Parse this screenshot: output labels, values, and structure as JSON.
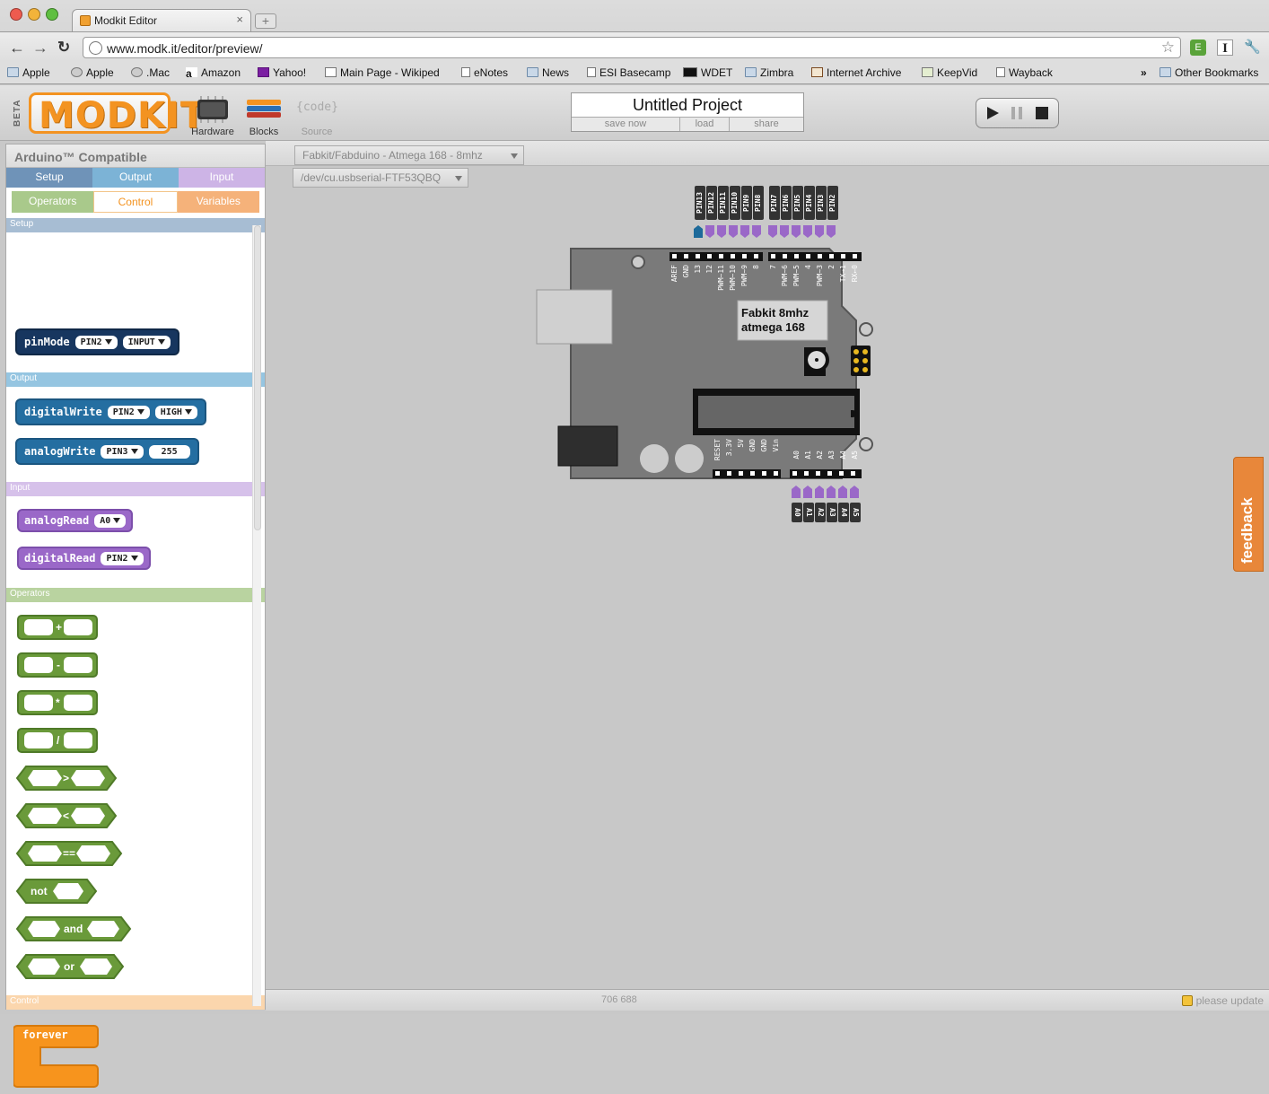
{
  "browser": {
    "tab_title": "Modkit Editor",
    "tab_close": "×",
    "new_tab": "+",
    "url": "www.modk.it/editor/preview/",
    "back": "←",
    "forward": "→",
    "reload": "C",
    "star": "☆",
    "bookmarks": [
      {
        "label": "Apple",
        "icon": "folder-icon"
      },
      {
        "label": "Apple",
        "icon": "apple-icon"
      },
      {
        "label": ".Mac",
        "icon": "apple-icon"
      },
      {
        "label": "Amazon",
        "icon": "amazon-icon"
      },
      {
        "label": "Yahoo!",
        "icon": "yahoo-icon"
      },
      {
        "label": "Main Page - Wikiped",
        "icon": "wikipedia-icon"
      },
      {
        "label": "eNotes",
        "icon": "page-icon"
      },
      {
        "label": "News",
        "icon": "folder-icon"
      },
      {
        "label": "ESI Basecamp",
        "icon": "page-icon"
      },
      {
        "label": "WDET",
        "icon": "wdet-icon"
      },
      {
        "label": "Zimbra",
        "icon": "folder-icon"
      },
      {
        "label": "Internet Archive",
        "icon": "archive-icon"
      },
      {
        "label": "KeepVid",
        "icon": "keepvid-icon"
      },
      {
        "label": "Wayback",
        "icon": "page-icon"
      }
    ],
    "more": "»",
    "other_bookmarks": "Other Bookmarks"
  },
  "app": {
    "logo": "MODKIT",
    "beta": "BETA",
    "modes": [
      {
        "label": "Hardware",
        "icon": "chip-icon"
      },
      {
        "label": "Blocks",
        "icon": "blocks-icon"
      },
      {
        "label": "Source",
        "icon_text": "{code}"
      }
    ],
    "project": {
      "name": "Untitled Project",
      "actions": [
        "save now",
        "load",
        "share"
      ]
    },
    "run_controls": [
      "play",
      "pause",
      "stop"
    ]
  },
  "sidebar": {
    "title": "Arduino™ Compatible",
    "tabs_row1": [
      "Setup",
      "Output",
      "Input"
    ],
    "tabs_row2": [
      "Operators",
      "Control",
      "Variables"
    ],
    "categories": {
      "setup": "Setup",
      "output": "Output",
      "input": "Input",
      "operators": "Operators",
      "control": "Control"
    },
    "blocks": {
      "pinMode": {
        "name": "pinMode",
        "pin": "PIN2",
        "mode": "INPUT"
      },
      "digitalWrite": {
        "name": "digitalWrite",
        "pin": "PIN2",
        "value": "HIGH"
      },
      "analogWrite": {
        "name": "analogWrite",
        "pin": "PIN3",
        "value": "255"
      },
      "analogRead": {
        "name": "analogRead",
        "pin": "A0"
      },
      "digitalRead": {
        "name": "digitalRead",
        "pin": "PIN2"
      },
      "ops": [
        "+",
        "-",
        "*",
        "/",
        ">",
        "<",
        "=="
      ],
      "not": "not",
      "and": "and",
      "or": "or",
      "forever": "forever"
    }
  },
  "canvas": {
    "board_select": "Fabkit/Fabduino - Atmega 168 - 8mhz",
    "port_select": "/dev/cu.usbserial-FTF53QBQ",
    "board_label": [
      "Fabkit 8mhz",
      "atmega 168"
    ],
    "top_pins": [
      "PIN13",
      "PIN12",
      "PIN11",
      "PIN10",
      "PIN9",
      "PIN8",
      "PIN7",
      "PIN6",
      "PIN5",
      "PIN4",
      "PIN3",
      "PIN2"
    ],
    "top_header_labels": [
      "AREF",
      "GND",
      "13",
      "12",
      "PWM~11",
      "PWM~10",
      "PWM~9",
      "8",
      "7",
      "PWM~6",
      "PWM~5",
      "4",
      "PWM~3",
      "2",
      "TX→1",
      "RX←0"
    ],
    "bottom_header_labels": [
      "RESET",
      "3.3V",
      "5V",
      "GND",
      "GND",
      "Vin",
      "A0",
      "A1",
      "A2",
      "A3",
      "A4",
      "A5"
    ],
    "bottom_pins": [
      "A0",
      "A1",
      "A2",
      "A3",
      "A4",
      "A5"
    ],
    "colors": {
      "pin_purple": "#9a68c8",
      "pin_active": "#1d6a9a",
      "board": "#7a7a7a"
    }
  },
  "status": {
    "coords": "706 688",
    "update": "please update"
  },
  "feedback": "feedback"
}
